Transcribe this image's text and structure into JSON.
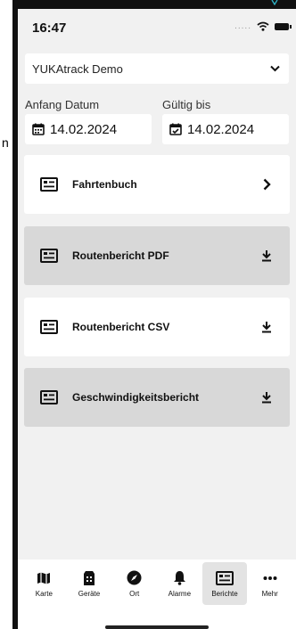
{
  "status": {
    "time": "16:47"
  },
  "vehicle": {
    "selected": "YUKAtrack Demo"
  },
  "dates": {
    "from_label": "Anfang Datum",
    "from_value": "14.02.2024",
    "to_label": "Gültig bis",
    "to_value": "14.02.2024"
  },
  "reports": [
    {
      "label": "Fahrtenbuch",
      "action": "chevron-right-icon"
    },
    {
      "label": "Routenbericht PDF",
      "action": "download-icon"
    },
    {
      "label": "Routenbericht CSV",
      "action": "download-icon"
    },
    {
      "label": "Geschwindigkeitsbericht",
      "action": "download-icon"
    }
  ],
  "tabs": [
    {
      "label": "Karte",
      "icon": "map-icon"
    },
    {
      "label": "Geräte",
      "icon": "device-icon"
    },
    {
      "label": "Ort",
      "icon": "compass-icon"
    },
    {
      "label": "Alarme",
      "icon": "bell-icon"
    },
    {
      "label": "Berichte",
      "icon": "report-icon",
      "active": true
    },
    {
      "label": "Mehr",
      "icon": "more-icon"
    }
  ],
  "colors": {
    "card_white": "#ffffff",
    "card_grey": "#d8d8d8",
    "screen_bg": "#f1f1f1"
  }
}
